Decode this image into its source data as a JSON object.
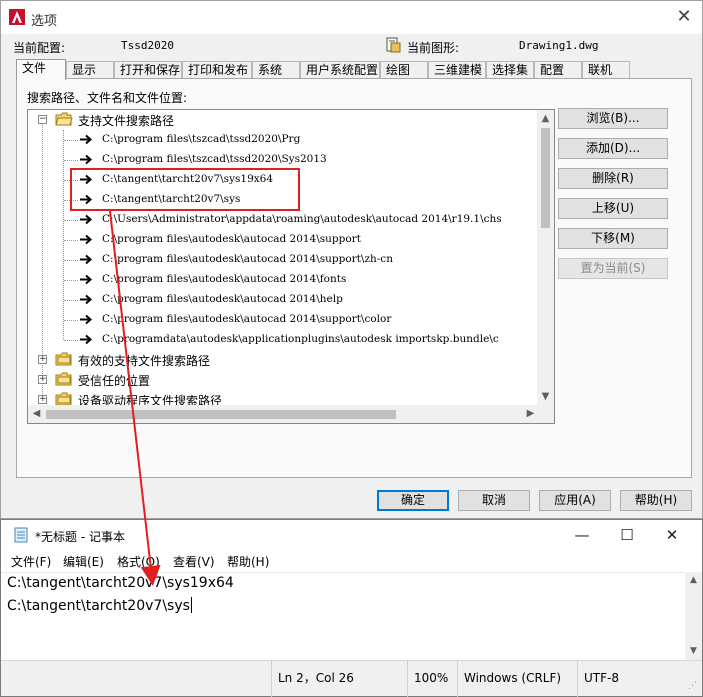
{
  "options": {
    "title": "选项",
    "current_profile_label": "当前配置:",
    "current_profile_value": "Tssd2020",
    "current_drawing_label": "当前图形:",
    "current_drawing_value": "Drawing1.dwg",
    "tabs": [
      "文件",
      "显示",
      "打开和保存",
      "打印和发布",
      "系统",
      "用户系统配置",
      "绘图",
      "三维建模",
      "选择集",
      "配置",
      "联机"
    ],
    "active_tab": "文件",
    "panel_label": "搜索路径、文件名和文件位置:",
    "tree": {
      "root_label": "支持文件搜索路径",
      "paths": [
        "C:\\program files\\tszcad\\tssd2020\\Prg",
        "C:\\program files\\tszcad\\tssd2020\\Sys2013",
        "C:\\tangent\\tarcht20v7\\sys19x64",
        "C:\\tangent\\tarcht20v7\\sys",
        "C:\\Users\\Administrator\\appdata\\roaming\\autodesk\\autocad 2014\\r19.1\\chs",
        "C:\\program files\\autodesk\\autocad 2014\\support",
        "C:\\program files\\autodesk\\autocad 2014\\support\\zh-cn",
        "C:\\program files\\autodesk\\autocad 2014\\fonts",
        "C:\\program files\\autodesk\\autocad 2014\\help",
        "C:\\program files\\autodesk\\autocad 2014\\support\\color",
        "C:\\programdata\\autodesk\\applicationplugins\\autodesk importskp.bundle\\c"
      ],
      "other_nodes": [
        "有效的支持文件搜索路径",
        "受信任的位置",
        "设备驱动程序文件搜索路径"
      ]
    },
    "side_buttons": {
      "browse": "浏览(B)...",
      "add": "添加(D)...",
      "remove": "删除(R)",
      "move_up": "上移(U)",
      "move_down": "下移(M)",
      "set_current": "置为当前(S)"
    },
    "bottom_buttons": {
      "ok": "确定",
      "cancel": "取消",
      "apply": "应用(A)",
      "help": "帮助(H)"
    }
  },
  "notepad": {
    "title": "*无标题 - 记事本",
    "menus": [
      "文件(F)",
      "编辑(E)",
      "格式(O)",
      "查看(V)",
      "帮助(H)"
    ],
    "lines": [
      "C:\\tangent\\tarcht20v7\\sys19x64",
      "C:\\tangent\\tarcht20v7\\sys"
    ],
    "status": {
      "position": "Ln 2，Col 26",
      "zoom": "100%",
      "line_ending": "Windows (CRLF)",
      "encoding": "UTF-8"
    }
  },
  "colors": {
    "annotation_red": "#e02020",
    "dialog_bg": "#f0f0f0",
    "default_button_border": "#0078d7"
  }
}
